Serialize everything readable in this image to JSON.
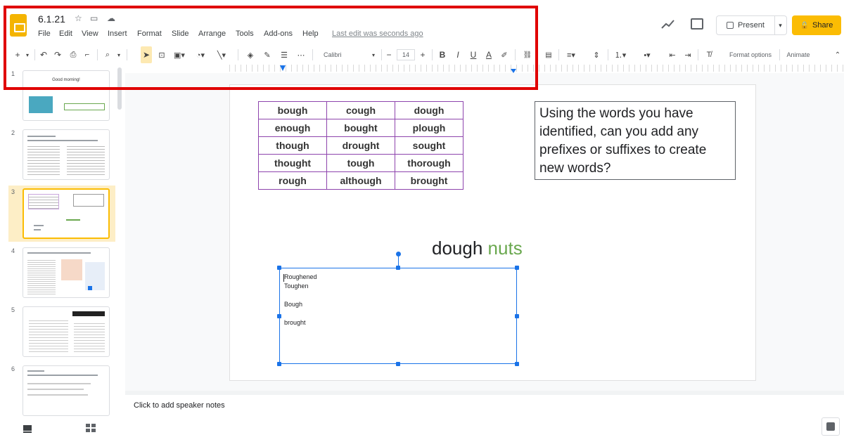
{
  "header": {
    "title": "6.1.21",
    "menus": [
      "File",
      "Edit",
      "View",
      "Insert",
      "Format",
      "Slide",
      "Arrange",
      "Tools",
      "Add-ons",
      "Help"
    ],
    "last_edit": "Last edit was seconds ago",
    "present_label": "Present",
    "share_label": "Share"
  },
  "toolbar": {
    "font": "Calibri",
    "font_size": "14",
    "format_options": "Format options",
    "animate": "Animate"
  },
  "filmstrip": {
    "slide_numbers": [
      "1",
      "2",
      "3",
      "4",
      "5",
      "6"
    ],
    "slide1_title": "Good morning!",
    "active_slide": 3
  },
  "slide": {
    "table": [
      [
        "bough",
        "cough",
        "dough"
      ],
      [
        "enough",
        "bought",
        "plough"
      ],
      [
        "though",
        "drought",
        "sought"
      ],
      [
        "thought",
        "tough",
        "thorough"
      ],
      [
        "rough",
        "although",
        "brought"
      ]
    ],
    "prompt": "Using the words you have identified, can you add any prefixes or suffixes to create new words?",
    "dough": "dough",
    "nuts": "nuts",
    "textbox_lines": [
      "Roughened",
      "Toughen",
      "Bough",
      "brought"
    ]
  },
  "notes": {
    "placeholder": "Click to add speaker notes"
  },
  "colors": {
    "accent_yellow": "#fbbc04",
    "selection_blue": "#1a73e8",
    "highlight_red": "#e00000",
    "table_border": "#8e44ad",
    "nuts_green": "#6aa84f"
  }
}
